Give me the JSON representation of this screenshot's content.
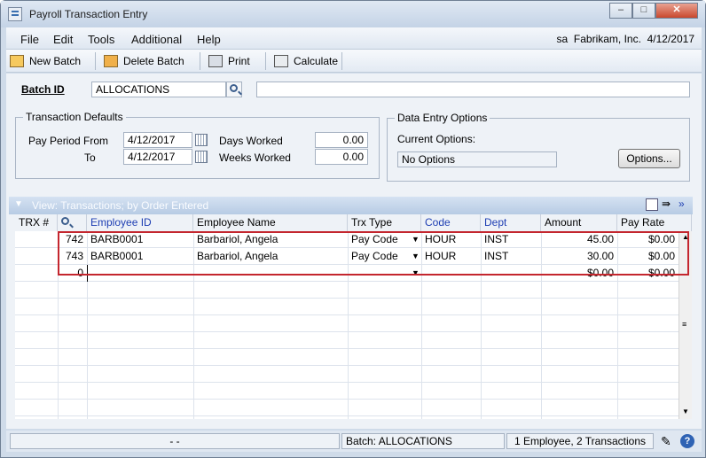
{
  "window": {
    "title": "Payroll Transaction Entry"
  },
  "menu": {
    "items": [
      "File",
      "Edit",
      "Tools",
      "Additional",
      "Help"
    ],
    "user": "sa",
    "company": "Fabrikam, Inc.",
    "date": "4/12/2017"
  },
  "toolbar": {
    "new_batch": "New Batch",
    "delete_batch": "Delete Batch",
    "print": "Print",
    "calculate": "Calculate"
  },
  "batch": {
    "label": "Batch ID",
    "value": "ALLOCATIONS",
    "comment": ""
  },
  "transaction_defaults": {
    "title": "Transaction Defaults",
    "pay_period_from_label": "Pay Period From",
    "pay_period_from": "4/12/2017",
    "to_label": "To",
    "to": "4/12/2017",
    "days_worked_label": "Days Worked",
    "days_worked": "0.00",
    "weeks_worked_label": "Weeks Worked",
    "weeks_worked": "0.00"
  },
  "data_entry_options": {
    "title": "Data Entry Options",
    "current_options_label": "Current Options:",
    "current_options": "No Options",
    "options_button": "Options..."
  },
  "grid": {
    "view_label": "View: Transactions; by Order Entered",
    "headers": [
      "TRX #",
      "Employee ID",
      "Employee Name",
      "Trx Type",
      "Code",
      "Dept",
      "Amount",
      "Pay Rate"
    ],
    "rows": [
      {
        "trx": "742",
        "employee_id": "BARB0001",
        "name": "Barbariol, Angela",
        "trx_type": "Pay Code",
        "code": "HOUR",
        "dept": "INST",
        "amount": "45.00",
        "pay_rate": "$0.00"
      },
      {
        "trx": "743",
        "employee_id": "BARB0001",
        "name": "Barbariol, Angela",
        "trx_type": "Pay Code",
        "code": "HOUR",
        "dept": "INST",
        "amount": "30.00",
        "pay_rate": "$0.00"
      },
      {
        "trx": "0",
        "employee_id": "",
        "name": "",
        "trx_type": "",
        "code": "",
        "dept": "",
        "amount": "$0.00",
        "pay_rate": "$0.00"
      }
    ]
  },
  "status": {
    "left": "- -",
    "batch": "Batch: ALLOCATIONS",
    "summary": "1 Employee, 2 Transactions"
  },
  "colors": {
    "accent": "#1f3fb3",
    "highlight": "#c4262e"
  }
}
